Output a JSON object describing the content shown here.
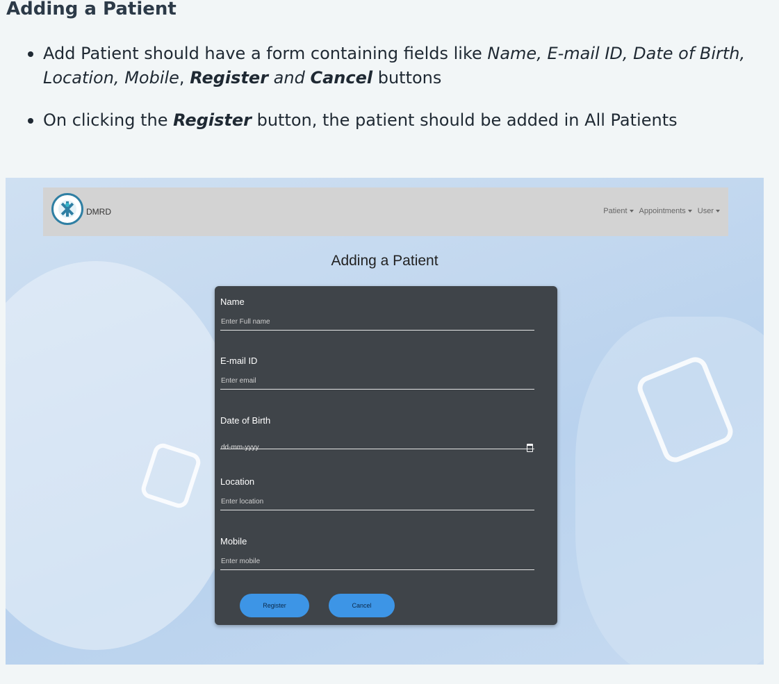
{
  "doc": {
    "heading": "Adding a Patient",
    "bullet1": {
      "t1": "Add Patient should have a form containing fields like ",
      "fields_list": "Name, E-mail ID, Date of Birth, Location, Mobile",
      "comma": ", ",
      "register": "Register",
      "and": " and ",
      "cancel": "Cancel",
      "t2": " buttons"
    },
    "bullet2": {
      "t1": "On clicking the ",
      "register": "Register",
      "t2": " button, the patient should be added in All Patients"
    }
  },
  "app": {
    "brand": "DMRD",
    "nav": [
      "Patient",
      "Appointments",
      "User"
    ],
    "form_title": "Adding a Patient",
    "fields": [
      {
        "label": "Name",
        "placeholder": "Enter Full name"
      },
      {
        "label": "E-mail ID",
        "placeholder": "Enter email"
      },
      {
        "label": "Date of Birth",
        "placeholder": "dd-mm-yyyy"
      },
      {
        "label": "Location",
        "placeholder": "Enter location"
      },
      {
        "label": "Mobile",
        "placeholder": "Enter mobile"
      }
    ],
    "register_label": "Register",
    "cancel_label": "Cancel",
    "colors": {
      "card_bg": "#3f4449",
      "button_bg": "#3d95e6",
      "navbar_bg": "#d3d3d3",
      "logo_accent": "#2f7fa3"
    },
    "icons": [
      "logo-icon",
      "calendar-icon",
      "caret-down-icon"
    ]
  }
}
